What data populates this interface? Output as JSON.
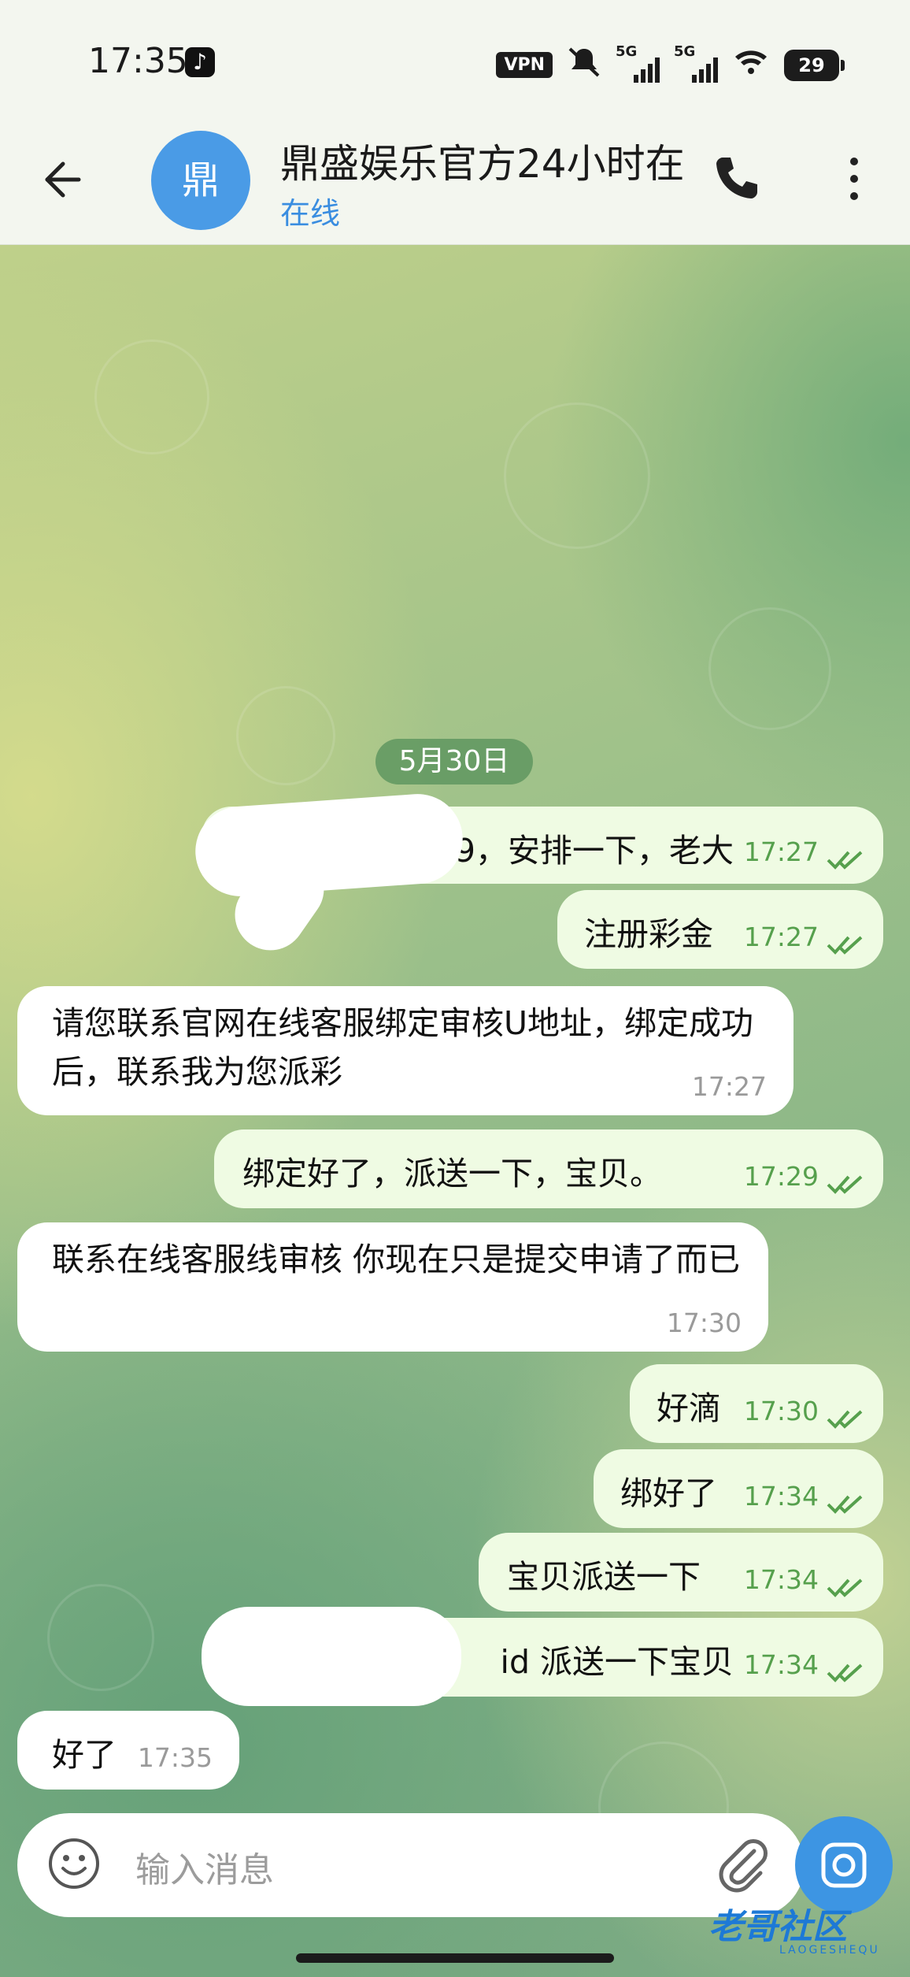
{
  "status_bar": {
    "time": "17:35",
    "vpn": "VPN",
    "net1": "5G",
    "net2": "5G",
    "battery": "29"
  },
  "header": {
    "avatar_char": "鼎",
    "title": "鼎盛娱乐官方24小时在",
    "status": "在线"
  },
  "chat": {
    "date_label": "5月30日",
    "messages": [
      {
        "dir": "out",
        "text": "69，安排一下，老大",
        "time": "17:27",
        "read": true
      },
      {
        "dir": "out",
        "text": "注册彩金",
        "time": "17:27",
        "read": true
      },
      {
        "dir": "in",
        "text": "请您联系官网在线客服绑定审核U地址，绑定成功后，联系我为您派彩",
        "time": "17:27"
      },
      {
        "dir": "out",
        "text": "绑定好了，派送一下，宝贝。",
        "time": "17:29",
        "read": true
      },
      {
        "dir": "in",
        "text": "联系在线客服线审核 你现在只是提交申请了而已",
        "time": "17:30"
      },
      {
        "dir": "out",
        "text": "好滴",
        "time": "17:30",
        "read": true
      },
      {
        "dir": "out",
        "text": "绑好了",
        "time": "17:34",
        "read": true
      },
      {
        "dir": "out",
        "text": "宝贝派送一下",
        "time": "17:34",
        "read": true
      },
      {
        "dir": "out",
        "text": "id 派送一下宝贝",
        "time": "17:34",
        "read": true
      },
      {
        "dir": "in",
        "text": "好了",
        "time": "17:35"
      }
    ]
  },
  "input": {
    "placeholder": "输入消息"
  },
  "watermark": {
    "text": "老哥社区",
    "sub": "LAOGESHEQU"
  },
  "colors": {
    "outgoing_bubble": "#effbe3",
    "incoming_bubble": "#ffffff",
    "accent": "#3d95e3",
    "tick": "#56a04d"
  }
}
